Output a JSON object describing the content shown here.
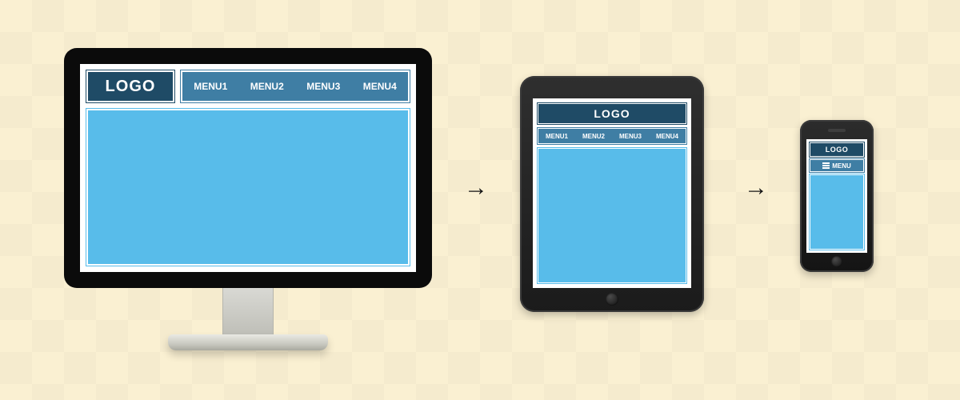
{
  "desktop": {
    "logo": "LOGO",
    "menu": [
      "MENU1",
      "MENU2",
      "MENU3",
      "MENU4"
    ]
  },
  "tablet": {
    "logo": "LOGO",
    "menu": [
      "MENU1",
      "MENU2",
      "MENU3",
      "MENU4"
    ]
  },
  "phone": {
    "logo": "LOGO",
    "menu_label": "MENU"
  },
  "arrows": {
    "glyph": "→"
  }
}
